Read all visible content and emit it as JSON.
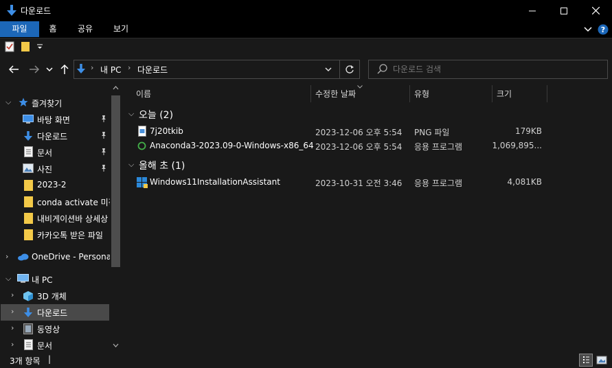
{
  "window": {
    "title": "다운로드",
    "controls": [
      "minimize-icon",
      "maximize-icon",
      "close-icon"
    ]
  },
  "ribbon": {
    "tabs": [
      "파일",
      "홈",
      "공유",
      "보기"
    ],
    "active_tab": "파일",
    "accent": "#1c67b8"
  },
  "address": {
    "crumbs": [
      "내 PC",
      "다운로드"
    ]
  },
  "search": {
    "placeholder": "다운로드 검색"
  },
  "nav": {
    "quick_access": "즐겨찾기",
    "items": [
      {
        "label": "바탕 화면",
        "icon": "desktop-icon",
        "pinned": true
      },
      {
        "label": "다운로드",
        "icon": "download-icon",
        "pinned": true
      },
      {
        "label": "문서",
        "icon": "document-icon",
        "pinned": true
      },
      {
        "label": "사진",
        "icon": "pictures-icon",
        "pinned": true
      },
      {
        "label": "2023-2",
        "icon": "folder-icon",
        "pinned": false
      },
      {
        "label": "conda activate 미작",
        "icon": "folder-icon",
        "pinned": false
      },
      {
        "label": "내비게이션바 상세상",
        "icon": "folder-icon",
        "pinned": false
      },
      {
        "label": "카카오톡 받은 파일",
        "icon": "folder-icon",
        "pinned": false
      }
    ],
    "onedrive": "OneDrive - Personal",
    "this_pc": "내 PC",
    "pc_items": [
      {
        "label": "3D 개체",
        "icon": "3d-objects-icon"
      },
      {
        "label": "다운로드",
        "icon": "download-icon",
        "selected": true
      },
      {
        "label": "동영상",
        "icon": "videos-icon"
      },
      {
        "label": "문서",
        "icon": "document-icon"
      }
    ]
  },
  "columns": [
    "이름",
    "수정한 날짜",
    "유형",
    "크기"
  ],
  "groups": [
    {
      "header": "오늘 (2)",
      "files": [
        {
          "name": "7j20tkib",
          "date": "2023-12-06 오후 5:54",
          "type": "PNG 파일",
          "size": "179KB",
          "icon": "image-file-icon"
        },
        {
          "name": "Anaconda3-2023.09-0-Windows-x86_64",
          "date": "2023-12-06 오후 5:54",
          "type": "응용 프로그램",
          "size": "1,069,895...",
          "icon": "anaconda-icon"
        }
      ]
    },
    {
      "header": "올해 초 (1)",
      "files": [
        {
          "name": "Windows11InstallationAssistant",
          "date": "2023-10-31 오전 3:46",
          "type": "응용 프로그램",
          "size": "4,081KB",
          "icon": "windows-installer-icon"
        }
      ]
    }
  ],
  "status": {
    "count": "3개 항목",
    "caret": "|"
  }
}
